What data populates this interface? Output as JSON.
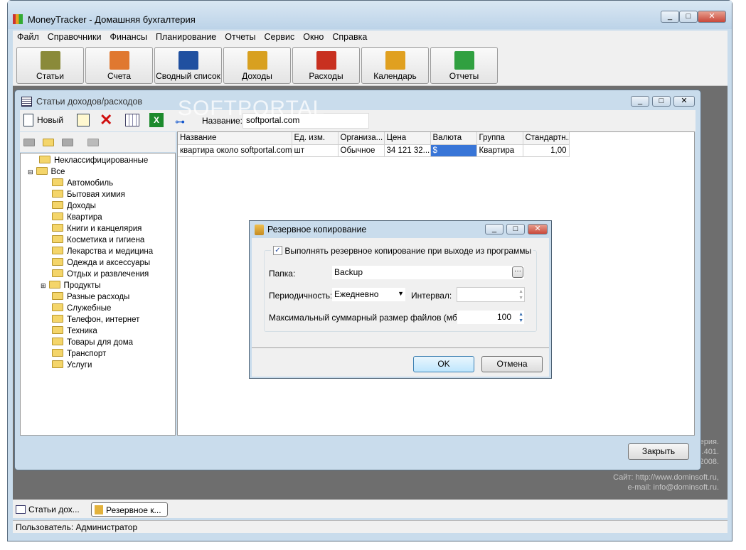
{
  "app": {
    "title": "MoneyTracker - Домашняя бухгалтерия"
  },
  "menu": [
    "Файл",
    "Справочники",
    "Финансы",
    "Планирование",
    "Отчеты",
    "Сервис",
    "Окно",
    "Справка"
  ],
  "toolbar": [
    {
      "label": "Статьи",
      "icon": "tree-icon"
    },
    {
      "label": "Счета",
      "icon": "accounts-icon"
    },
    {
      "label": "Сводный список",
      "icon": "list-icon"
    },
    {
      "label": "Доходы",
      "icon": "income-coins-icon"
    },
    {
      "label": "Расходы",
      "icon": "expense-coins-icon"
    },
    {
      "label": "Календарь",
      "icon": "calendar-icon"
    },
    {
      "label": "Отчеты",
      "icon": "bar-chart-icon"
    }
  ],
  "child": {
    "title": "Статьи доходов/расходов",
    "new_label": "Новый",
    "filter_label": "Название:",
    "filter_value": "softportal.com",
    "tree": {
      "root_items": [
        "Неклассифицированные",
        "Все"
      ],
      "children": [
        "Автомобиль",
        "Бытовая химия",
        "Доходы",
        "Квартира",
        "Книги и канцелярия",
        "Косметика и гигиена",
        "Лекарства и медицина",
        "Одежда и аксессуары",
        "Отдых и развлечения",
        "Продукты",
        "Разные расходы",
        "Служебные",
        "Телефон, интернет",
        "Техника",
        "Товары для дома",
        "Транспорт",
        "Услуги"
      ]
    },
    "grid": {
      "columns": [
        "Название",
        "Ед. изм.",
        "Организа...",
        "Цена",
        "Валюта",
        "Группа",
        "Стандартн..."
      ],
      "rows": [
        [
          "квартира около softportal.com",
          "шт",
          "Обычное",
          "34 121 32...",
          "$",
          "Квартира",
          "1,00"
        ]
      ]
    },
    "close_label": "Закрыть"
  },
  "dialog": {
    "title": "Резервное копирование",
    "checkbox_label": "Выполнять резервное копирование при выходе из программы",
    "checked": true,
    "folder_label": "Папка:",
    "folder_value": "Backup",
    "period_label": "Периодичность:",
    "period_value": "Ежедневно",
    "interval_label": "Интервал:",
    "interval_value": "",
    "max_label": "Максимальный суммарный размер файлов (мб):",
    "max_value": "100",
    "ok": "OK",
    "cancel": "Отмена"
  },
  "background_info": [
    "ерия.",
    ".401.",
    "2008.",
    "Сайт: http://www.dominsoft.ru,",
    "e-mail: info@dominsoft.ru."
  ],
  "taskbar": [
    "Статьи дох...",
    "Резервное к..."
  ],
  "status": "Пользователь: Администратор",
  "watermark": "SOFTPORTAL"
}
